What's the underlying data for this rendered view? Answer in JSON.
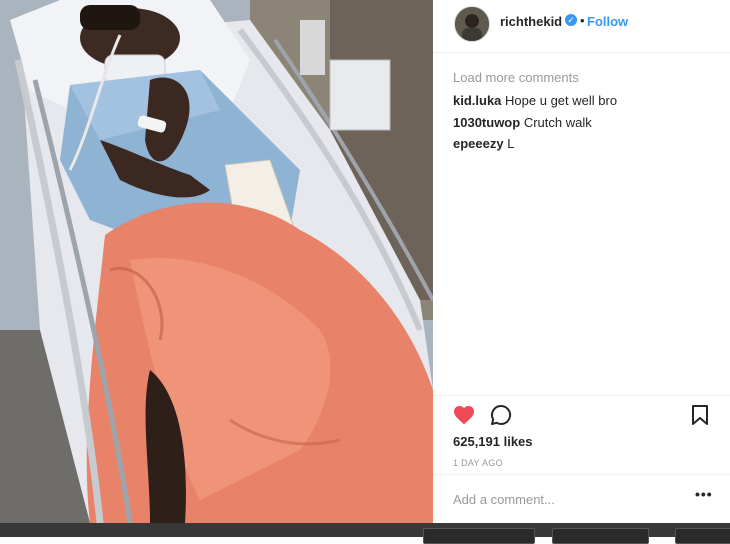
{
  "post": {
    "username": "richthekid",
    "verified": true,
    "follow_label": "Follow",
    "separator": "•"
  },
  "comments": {
    "load_more": "Load more comments",
    "items": [
      {
        "user": "kid.luka",
        "text": "Hope u get well bro"
      },
      {
        "user": "1030tuwop",
        "text": "Crutch walk"
      },
      {
        "user": "epeeezy",
        "text": "L"
      }
    ]
  },
  "engagement": {
    "likes": "625,191 likes",
    "time_ago": "1 DAY AGO",
    "liked": true
  },
  "composer": {
    "placeholder": "Add a comment...",
    "more_label": "•••"
  },
  "colors": {
    "accent": "#3897f0",
    "heart": "#ed4956",
    "text": "#262626",
    "muted": "#999999"
  },
  "icons": {
    "like": "heart-icon",
    "comment": "comment-icon",
    "save": "bookmark-icon",
    "verified": "verified-badge-icon"
  }
}
